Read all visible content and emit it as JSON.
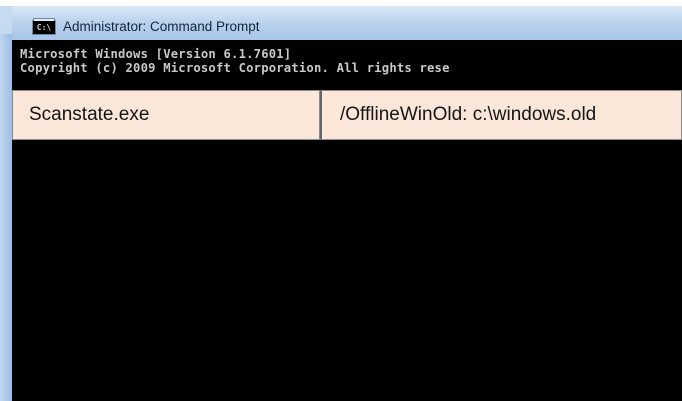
{
  "window": {
    "title": "Administrator: Command Prompt",
    "icon_label": "C:\\",
    "icon": "cmd-icon"
  },
  "console": {
    "lines": [
      "Microsoft Windows [Version 6.1.7601]",
      "Copyright (c) 2009 Microsoft Corporation.  All rights rese"
    ]
  },
  "overlay": {
    "command": "Scanstate.exe",
    "argument": "/OfflineWinOld: c:\\windows.old"
  },
  "colors": {
    "console_bg": "#000000",
    "console_text": "#c9c9c9",
    "overlay_bg": "#fbe7da",
    "titlebar": "#b7d0ec"
  }
}
